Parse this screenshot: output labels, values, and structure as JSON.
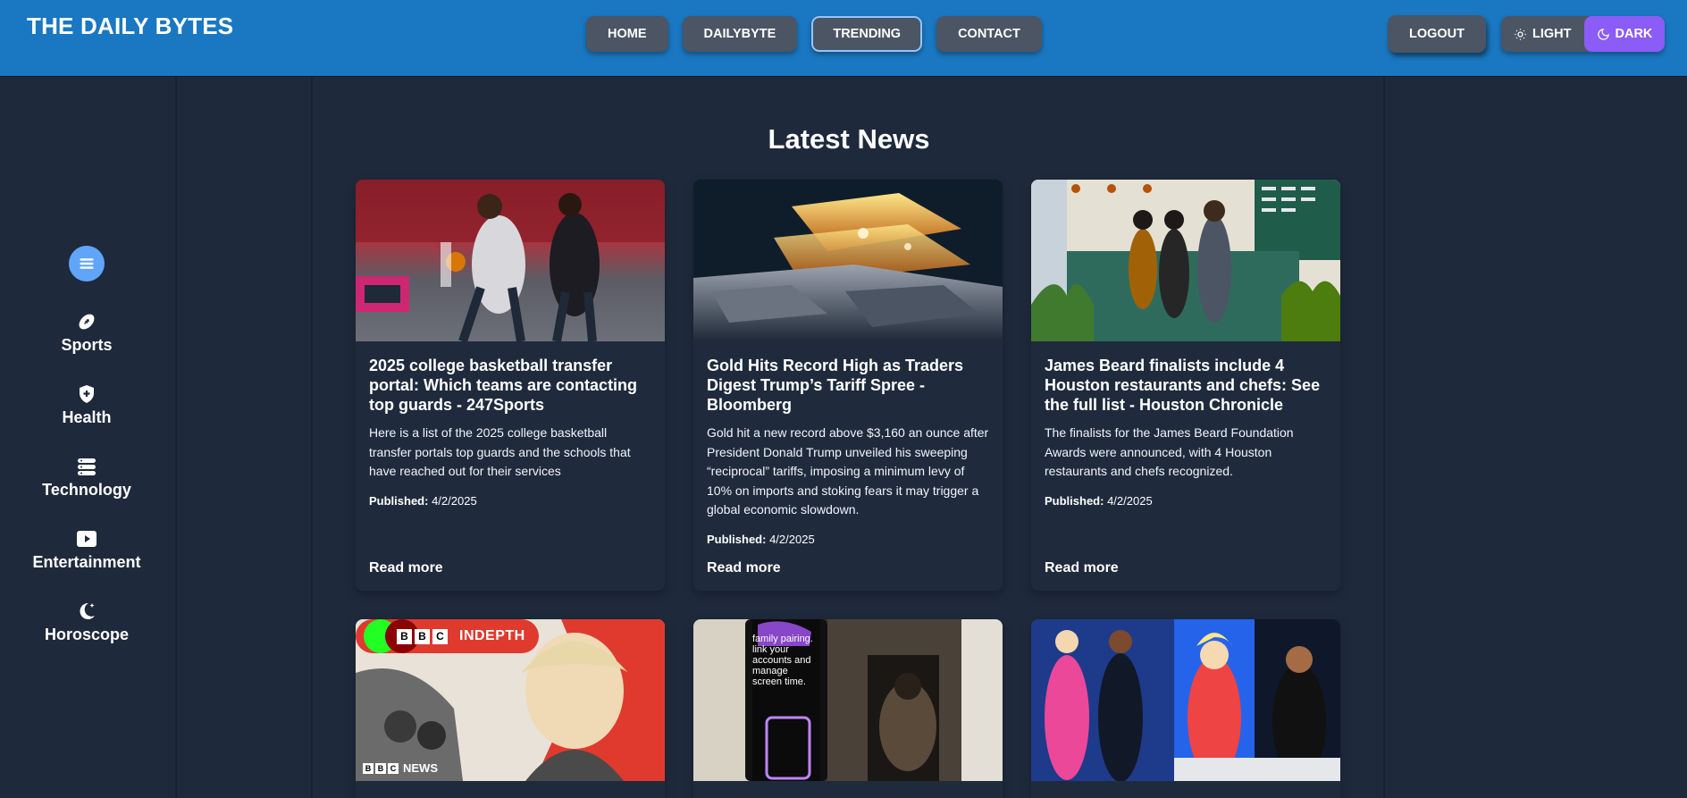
{
  "header": {
    "brand": "THE DAILY BYTES",
    "nav": [
      "HOME",
      "DAILYBYTE",
      "TRENDING",
      "CONTACT"
    ],
    "active_nav": "TRENDING",
    "logout": "LOGOUT",
    "theme_light": "LIGHT",
    "theme_dark": "DARK"
  },
  "sidebar": {
    "items": [
      {
        "label": "Sports",
        "icon": "football-icon"
      },
      {
        "label": "Health",
        "icon": "shield-plus-icon"
      },
      {
        "label": "Technology",
        "icon": "server-icon"
      },
      {
        "label": "Entertainment",
        "icon": "play-icon"
      },
      {
        "label": "Horoscope",
        "icon": "moon-stars-icon"
      }
    ]
  },
  "main": {
    "title": "Latest News",
    "cards": [
      {
        "title": "2025 college basketball transfer portal: Which teams are contacting top guards - 247Sports",
        "desc": "Here is a list of the 2025 college basketball transfer portals top guards and the schools that have reached out for their services",
        "published_label": "Published:",
        "date": "4/2/2025",
        "read_more": "Read more"
      },
      {
        "title": "Gold Hits Record High as Traders Digest Trump’s Tariff Spree - Bloomberg",
        "desc": "Gold hit a new record above $3,160 an ounce after President Donald Trump unveiled his sweeping “reciprocal” tariffs, imposing a minimum levy of 10% on imports and stoking fears it may trigger a global economic slowdown.",
        "published_label": "Published:",
        "date": "4/2/2025",
        "read_more": "Read more"
      },
      {
        "title": "James Beard finalists include 4 Houston restaurants and chefs: See the full list - Houston Chronicle",
        "desc": "The finalists for the James Beard Foundation Awards were announced, with 4 Houston restaurants and chefs recognized.",
        "published_label": "Published:",
        "date": "4/2/2025",
        "read_more": "Read more"
      }
    ],
    "image_texts": {
      "bbc_indepth": "INDEPTH",
      "bbc_news": "NEWS",
      "bbc_letters": [
        "B",
        "B",
        "C"
      ],
      "tiktok_screen": "family pairing. link your accounts and manage screen time."
    }
  },
  "colors": {
    "header_bg": "#1a78c2",
    "page_bg": "#1e293b",
    "card_bg": "#1f2b3d",
    "nav_btn": "#4b5563",
    "dark_btn": "#8b5cf6",
    "menu_toggle": "#60a5fa"
  }
}
